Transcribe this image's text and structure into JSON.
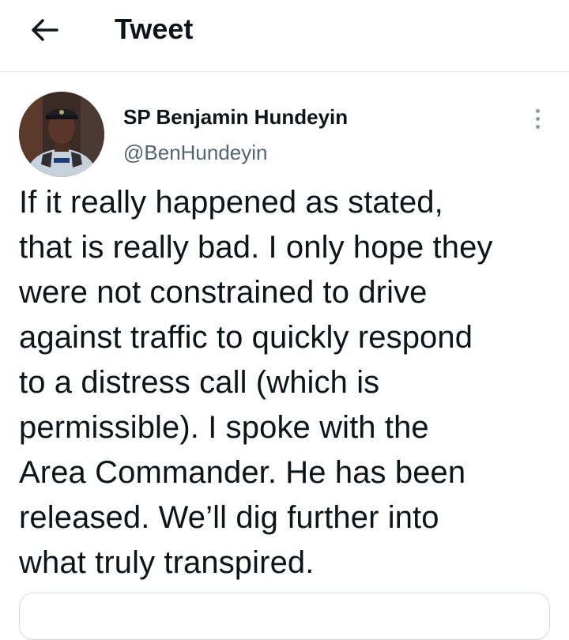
{
  "header": {
    "title": "Tweet"
  },
  "icons": {
    "back": "arrow-left-icon",
    "more": "more-vertical-icon"
  },
  "tweet": {
    "author_name": "SP Benjamin Hundeyin",
    "author_handle": "@BenHundeyin",
    "text_lines": [
      "If it really happened as stated,",
      "that is really bad. I only hope they",
      "were not constrained to drive",
      "against traffic to quickly respond",
      "to a distress call (which is",
      "permissible). I spoke with the",
      "Area Commander. He has been",
      "released. We’ll dig further into",
      "what truly transpired."
    ]
  },
  "colors": {
    "text_primary": "#0f1419",
    "text_secondary": "#536471",
    "divider": "#e6e6e6",
    "card_border": "#cfd9de"
  }
}
